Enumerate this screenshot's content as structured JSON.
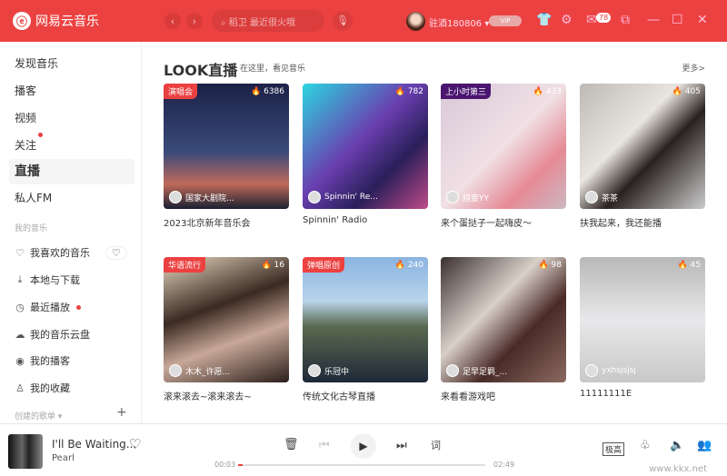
{
  "header": {
    "app_name": "网易云音乐",
    "search_placeholder": "稻卫 最近很火哦",
    "username": "驻酒180806",
    "vip_label": "VIP",
    "message_count": "78"
  },
  "sidebar": {
    "items": [
      {
        "label": "发现音乐"
      },
      {
        "label": "播客"
      },
      {
        "label": "视频"
      },
      {
        "label": "关注",
        "dot": true
      },
      {
        "label": "直播",
        "active": true
      },
      {
        "label": "私人FM"
      }
    ],
    "my_music_title": "我的音乐",
    "my_music": [
      {
        "label": "我喜欢的音乐",
        "icon": "heart-icon"
      },
      {
        "label": "本地与下载",
        "icon": "download-icon"
      },
      {
        "label": "最近播放",
        "icon": "clock-icon"
      },
      {
        "label": "我的音乐云盘",
        "icon": "cloud-icon"
      },
      {
        "label": "我的播客",
        "icon": "podcast-icon"
      },
      {
        "label": "我的收藏",
        "icon": "collection-icon"
      }
    ],
    "created_playlists": "创建的歌单"
  },
  "main": {
    "title": "LOOK直播",
    "subtitle": "在这里，看见音乐",
    "more": "更多>",
    "cards": [
      {
        "tag": "演唱会",
        "count": "6386",
        "host": "国家大剧院...",
        "title": "2023北京新年音乐会",
        "bg": "linear-gradient(180deg,#1c2147,#3a4b7a 55%,#c06a5a 80%,#1a2030)",
        "tagcolor": "#ec4141"
      },
      {
        "tag": "",
        "count": "782",
        "host": "Spinnin' Re...",
        "title": "Spinnin' Radio",
        "bg": "linear-gradient(135deg,#2bd6e0,#6a3fb0 45%,#2a1f5a 70%,#c04a8a)",
        "tagcolor": ""
      },
      {
        "tag": "上小时第三",
        "count": "433",
        "host": "媗妾YY",
        "title": "来个蛋挞子一起嗨皮～",
        "bg": "linear-gradient(135deg,#d8c8d8,#f0e0e4 50%,#e58a96 75%,#cdb8c0)",
        "tagcolor": "#4a1670"
      },
      {
        "tag": "",
        "count": "405",
        "host": "茶茶",
        "title": "扶我起来，我还能播",
        "bg": "linear-gradient(135deg,#bdbab5,#e8e4de 40%,#2a2220 60%,#ccc)",
        "tagcolor": ""
      },
      {
        "tag": "华语流行",
        "count": "16",
        "host": "木木_许愿...",
        "title": "滚来滚去~滚来滚去~",
        "bg": "linear-gradient(160deg,#e8d8c0,#3a2a22 40%,#c8a898 65%,#2a1e1a)",
        "tagcolor": "#ec4141"
      },
      {
        "tag": "弹唱原创",
        "count": "240",
        "host": "乐冠中",
        "title": "传统文化古琴直播",
        "bg": "linear-gradient(180deg,#8ab4e0,#b8d4ec 35%,#5a6a50 55%,#1e2838)",
        "tagcolor": "#ec4141"
      },
      {
        "tag": "",
        "count": "98",
        "host": "足早足羁_...",
        "title": "来看看游戏吧",
        "bg": "linear-gradient(135deg,#3a3030,#d8d0c8 40%,#4a2a28 65%,#8a6a60)",
        "tagcolor": ""
      },
      {
        "tag": "",
        "count": "45",
        "host": "yxhsjsjsj",
        "title": "11111111E",
        "bg": "linear-gradient(180deg,#b8b8b8,#e8e8ea 50%,#c8c8c8)",
        "tagcolor": ""
      }
    ]
  },
  "player": {
    "song": "I'll Be Waiting...",
    "artist": "Pearl",
    "current_time": "00:03",
    "total_time": "02:49",
    "progress_percent": 1.8,
    "lyrics_label": "词",
    "quality_label": "极高",
    "watermark": "www.kkx.net"
  },
  "colors": {
    "brand": "#ec4141"
  }
}
